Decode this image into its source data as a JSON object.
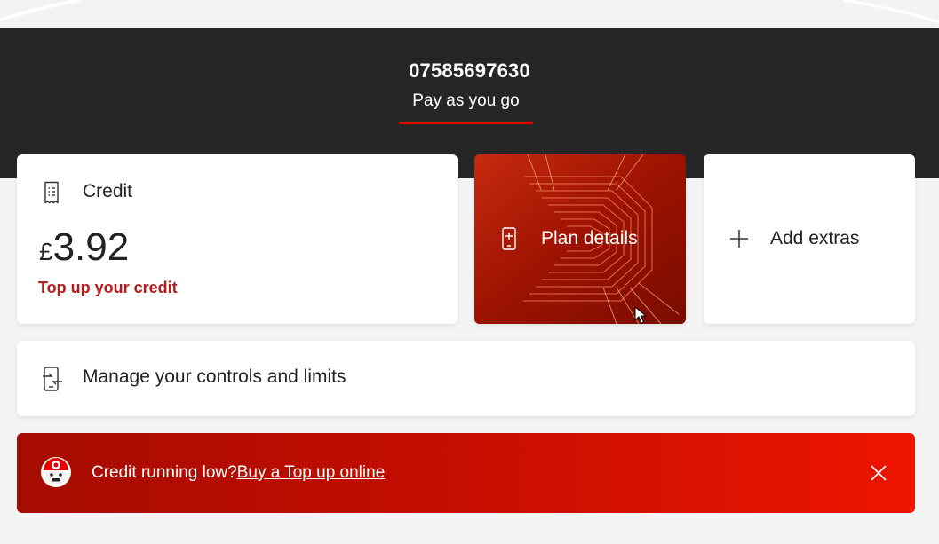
{
  "header": {
    "phone_number": "07585697630",
    "plan_tab": "Pay as you go"
  },
  "credit": {
    "title": "Credit",
    "currency_symbol": "£",
    "amount": "3.92",
    "topup_link": "Top up your credit",
    "icon": "receipt-icon"
  },
  "plan": {
    "label": "Plan details",
    "icon": "phone-plus-icon"
  },
  "extras": {
    "label": "Add extras",
    "icon": "plus-icon"
  },
  "controls": {
    "label": "Manage your controls and limits",
    "icon": "phone-settings-icon"
  },
  "banner": {
    "text": "Credit running low?",
    "link": "Buy a Top up online",
    "icon": "mascot-icon",
    "close_icon": "close-icon"
  },
  "colors": {
    "brand_red": "#e60000",
    "header_bg": "#262626",
    "link_red": "#b71c1c"
  }
}
